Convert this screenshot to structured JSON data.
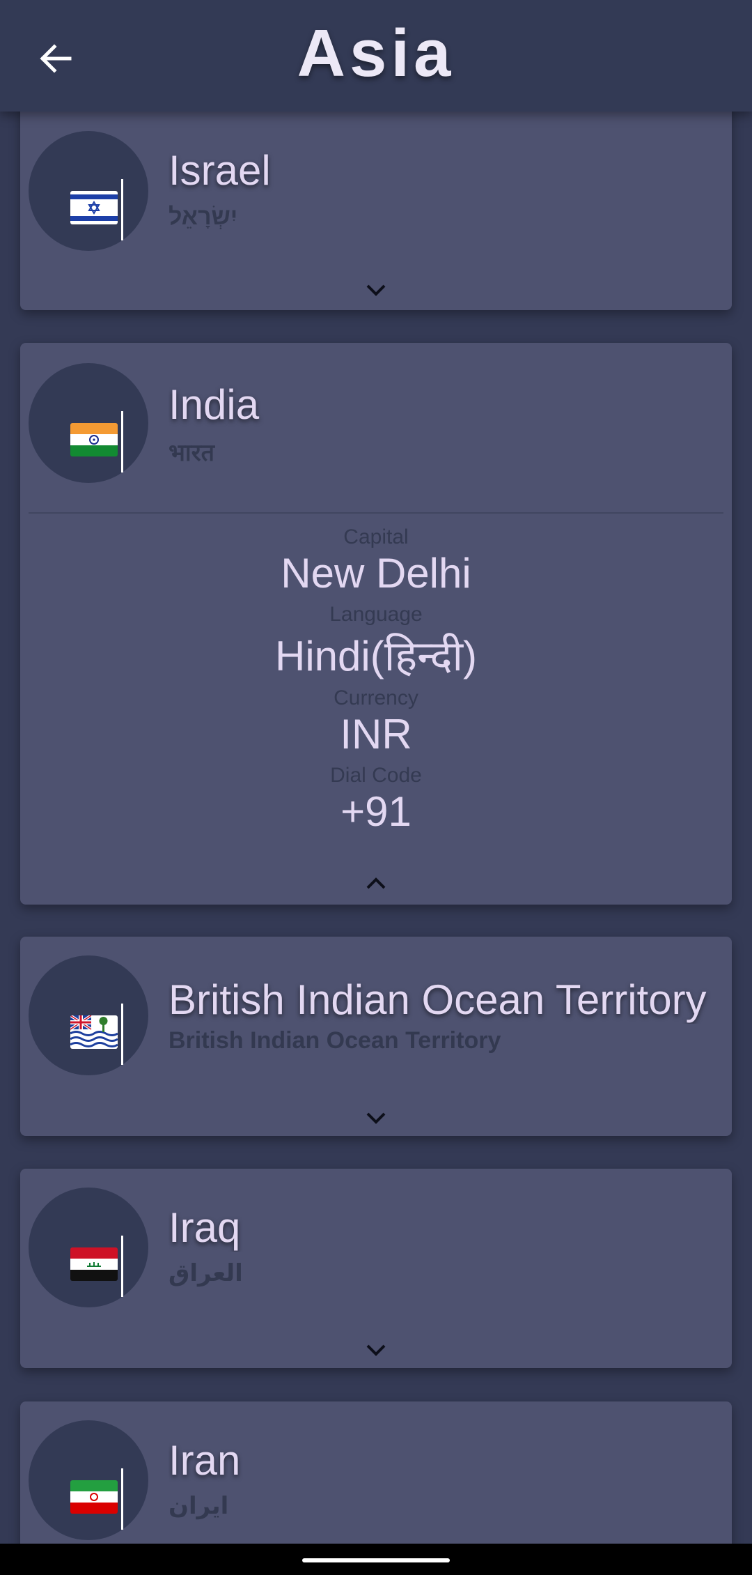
{
  "header": {
    "title": "Asia",
    "back_icon": "arrow-left-icon"
  },
  "countries": [
    {
      "name": "Israel",
      "native": "יִשְׂרָאֵל",
      "flag": "flag-israel-icon",
      "expanded": false
    },
    {
      "name": "India",
      "native": "भारत",
      "flag": "flag-india-icon",
      "expanded": true,
      "details": {
        "capital_label": "Capital",
        "capital": "New Delhi",
        "language_label": "Language",
        "language": "Hindi(हिन्दी)",
        "currency_label": "Currency",
        "currency": "INR",
        "dial_label": "Dial Code",
        "dial": "+91"
      }
    },
    {
      "name": "British Indian Ocean Territory",
      "native": "British Indian Ocean Territory",
      "flag": "flag-british-indian-ocean-territory-icon",
      "expanded": false
    },
    {
      "name": "Iraq",
      "native": "العراق",
      "flag": "flag-iraq-icon",
      "expanded": false
    },
    {
      "name": "Iran",
      "native": "ایران",
      "flag": "flag-iran-icon",
      "expanded": false
    }
  ],
  "colors": {
    "background": "#343a55",
    "card": "#4e5270",
    "text": "#e3d8f2"
  }
}
